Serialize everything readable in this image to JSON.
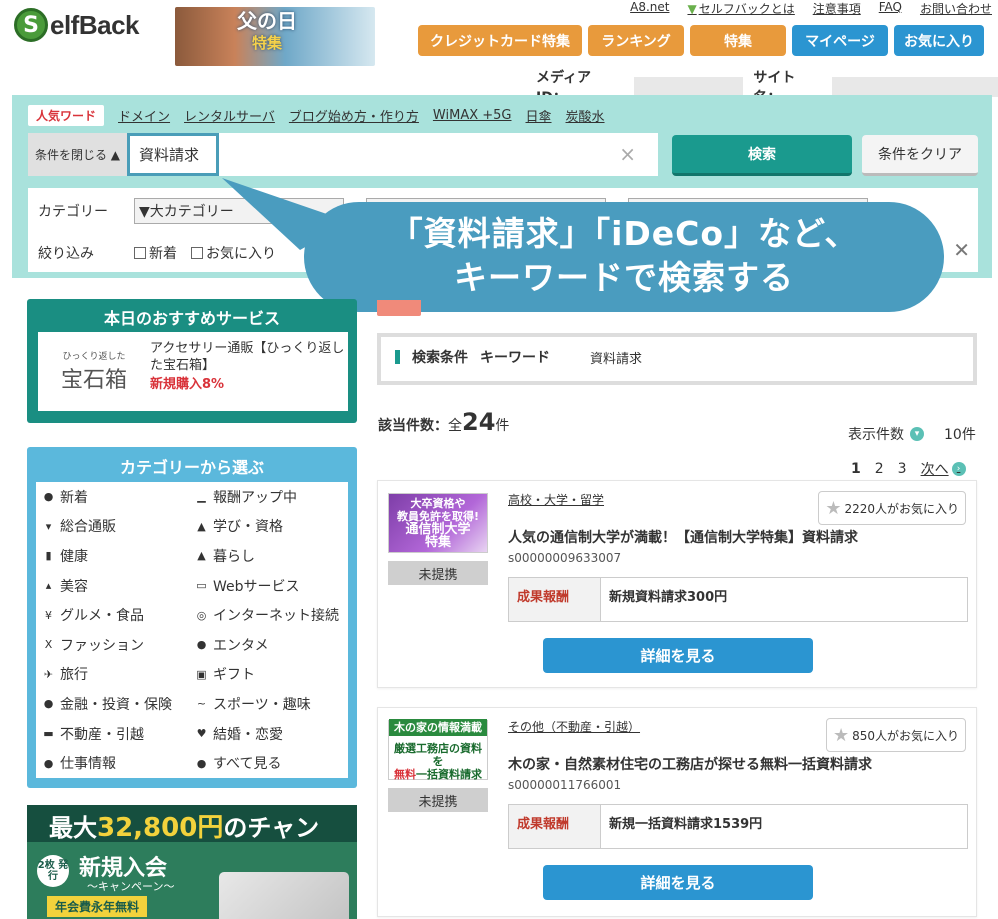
{
  "header": {
    "logo_letter": "S",
    "logo_text": "elfBack",
    "banner_title": "父の日",
    "banner_sub": "特集",
    "top_links": [
      "A8.net",
      "セルフバックとは",
      "注意事項",
      "FAQ",
      "お問い合わせ"
    ],
    "nav_buttons": [
      {
        "label": "クレジットカード特集",
        "color": "orange"
      },
      {
        "label": "ランキング",
        "color": "orange"
      },
      {
        "label": "特集",
        "color": "orange"
      },
      {
        "label": "マイページ",
        "color": "blue"
      },
      {
        "label": "お気に入り",
        "color": "blue"
      }
    ],
    "media_id_label": "メディアID：",
    "site_name_label": "サイト名："
  },
  "search": {
    "popular_tag": "人気ワード",
    "popular_words": [
      "ドメイン",
      "レンタルサーバ",
      "ブログ始め方・作り方",
      "WiMAX +5G",
      "日傘",
      "炭酸水"
    ],
    "toggle_label": "条件を閉じる ▲",
    "keyword": "資料請求",
    "clear_x": "×",
    "search_button": "検索",
    "clear_button": "条件をクリア",
    "category_label": "カテゴリー",
    "category_select": "▼大カテゴリー",
    "filter_label": "絞り込み",
    "filter_new": "新着",
    "filter_fav": "お気に入り"
  },
  "callout": {
    "line1": "「資料請求」「iDeCo」など、",
    "line2": "キーワードで検索する"
  },
  "recommend": {
    "title": "本日のおすすめサービス",
    "logo_small": "ひっくり返した",
    "logo_big": "宝石箱",
    "name": "アクセサリー通販【ひっくり返した宝石箱】",
    "reward": "新規購入8%"
  },
  "categories": {
    "title": "カテゴリーから選ぶ",
    "left": [
      {
        "label": "新着",
        "icon": "speech-icon",
        "glyph": "●"
      },
      {
        "label": "総合通販",
        "icon": "cart-icon",
        "glyph": "▾"
      },
      {
        "label": "健康",
        "icon": "bottle-icon",
        "glyph": "▮"
      },
      {
        "label": "美容",
        "icon": "lipstick-icon",
        "glyph": "▴"
      },
      {
        "label": "グルメ・食品",
        "icon": "fork-icon",
        "glyph": "¥"
      },
      {
        "label": "ファッション",
        "icon": "dress-icon",
        "glyph": "X"
      },
      {
        "label": "旅行",
        "icon": "plane-icon",
        "glyph": "✈"
      },
      {
        "label": "金融・投資・保険",
        "icon": "moneybag-icon",
        "glyph": "●"
      },
      {
        "label": "不動産・引越",
        "icon": "truck-icon",
        "glyph": "▬"
      },
      {
        "label": "仕事情報",
        "icon": "person-icon",
        "glyph": "●"
      }
    ],
    "right": [
      {
        "label": "報酬アップ中",
        "icon": "chart-up-icon",
        "glyph": "▁"
      },
      {
        "label": "学び・資格",
        "icon": "graduation-icon",
        "glyph": "▲"
      },
      {
        "label": "暮らし",
        "icon": "house-icon",
        "glyph": "▲"
      },
      {
        "label": "Webサービス",
        "icon": "monitor-icon",
        "glyph": "▭"
      },
      {
        "label": "インターネット接続",
        "icon": "globe-icon",
        "glyph": "◎"
      },
      {
        "label": "エンタメ",
        "icon": "camera-icon",
        "glyph": "●"
      },
      {
        "label": "ギフト",
        "icon": "gift-icon",
        "glyph": "▣"
      },
      {
        "label": "スポーツ・趣味",
        "icon": "dumbbell-icon",
        "glyph": "~"
      },
      {
        "label": "結婚・恋愛",
        "icon": "heart-icon",
        "glyph": "♥"
      },
      {
        "label": "すべて見る",
        "icon": "binoculars-icon",
        "glyph": "●"
      }
    ]
  },
  "promo": {
    "title_pre": "最大",
    "title_amount": "32,800円",
    "title_post": "のチャンス!!",
    "badge": "2枚\n発行",
    "big": "新規入会",
    "sub": "〜キャンペーン〜",
    "free": "年会費永年無料"
  },
  "results": {
    "cond_label": "検索条件",
    "cond_key": "キーワード",
    "cond_value": "資料請求",
    "count_label": "該当件数：",
    "count_pre": "全",
    "count_num": "24",
    "count_unit": "件",
    "perpage_label": "表示件数",
    "perpage_value": "10件",
    "pages": [
      "1",
      "2",
      "3"
    ],
    "next": "次へ",
    "items": [
      {
        "thumb_l1": "大卒資格や",
        "thumb_l2": "教員免許を取得!",
        "thumb_l3": "通信制大学",
        "thumb_l4": "特集",
        "status": "未提携",
        "category": "高校・大学・留学",
        "fav": "2220人がお気に入り",
        "title": "人気の通信制大学が満載！【通信制大学特集】資料請求",
        "pid": "s00000009633007",
        "reward_label": "成果報酬",
        "reward_value": "新規資料請求300円",
        "button": "詳細を見る"
      },
      {
        "thumb_l1": "木の家の情報満載",
        "thumb_l2": "厳選工務店の資料を",
        "thumb_l3": "無料",
        "thumb_l4": "一括資料請求",
        "status": "未提携",
        "category": "その他（不動産・引越）",
        "fav": "850人がお気に入り",
        "title": "木の家・自然素材住宅の工務店が探せる無料一括資料請求",
        "pid": "s00000011766001",
        "reward_label": "成果報酬",
        "reward_value": "新規一括資料請求1539円",
        "button": "詳細を見る"
      }
    ]
  }
}
